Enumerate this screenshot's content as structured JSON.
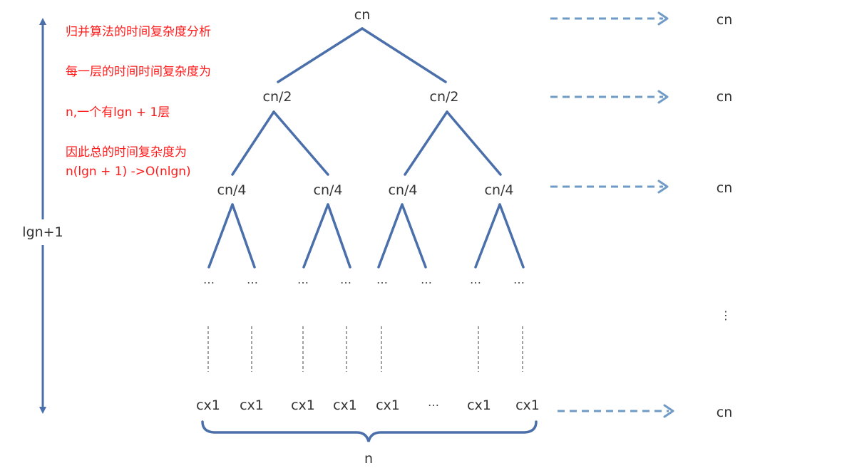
{
  "notes": [
    "归并算法的时间复杂度分析",
    "每一层的时间时间复杂度为",
    "n,一个有lgn + 1层",
    "因此总的时间复杂度为",
    "n(lgn + 1) ->O(nlgn)"
  ],
  "axis_label": "lgn+1",
  "tree": {
    "root": "cn",
    "level1": [
      "cn/2",
      "cn/2"
    ],
    "level2": [
      "cn/4",
      "cn/4",
      "cn/4",
      "cn/4"
    ],
    "ellipsis": "…",
    "leaves": [
      "cx1",
      "cx1",
      "cx1",
      "cx1",
      "cx1",
      "…",
      "cx1",
      "cx1"
    ],
    "brace_label": "n"
  },
  "level_costs": [
    "cn",
    "cn",
    "cn",
    "cn"
  ],
  "vertical_ellipsis": "⋮",
  "colors": {
    "tree_lines": "#4a6faa",
    "arrows": "#6f9bc6",
    "notes": "#ff1a1a",
    "labels": "#333333"
  }
}
